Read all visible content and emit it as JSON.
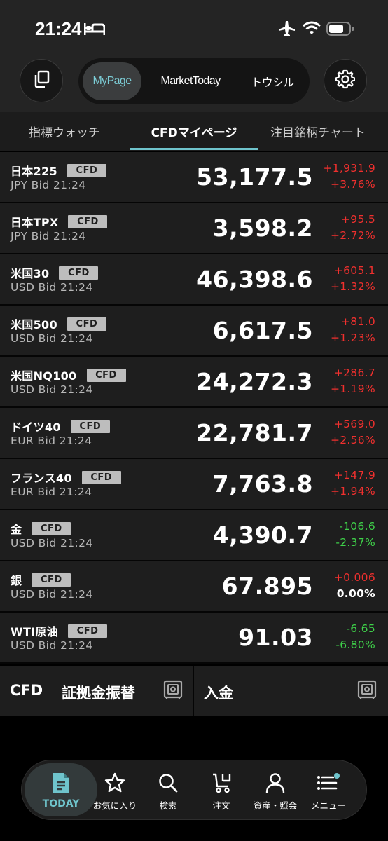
{
  "status": {
    "time": "21:24"
  },
  "header": {
    "segments": [
      {
        "label": "MyPage",
        "active": true
      },
      {
        "label": "MarketToday",
        "active": false
      },
      {
        "label": "トウシル",
        "active": false
      }
    ]
  },
  "tabs": [
    {
      "label": "指標ウォッチ",
      "active": false
    },
    {
      "label": "CFDマイページ",
      "active": true
    },
    {
      "label": "注目銘柄チャート",
      "active": false
    }
  ],
  "rows": [
    {
      "name": "日本225",
      "badge": "CFD",
      "sub": "JPY Bid 21:24",
      "price": "53,177.5",
      "change": "+1,931.9",
      "pct": "+3.76%",
      "dir": "up"
    },
    {
      "name": "日本TPX",
      "badge": "CFD",
      "sub": "JPY Bid 21:24",
      "price": "3,598.2",
      "change": "+95.5",
      "pct": "+2.72%",
      "dir": "up"
    },
    {
      "name": "米国30",
      "badge": "CFD",
      "sub": "USD Bid 21:24",
      "price": "46,398.6",
      "change": "+605.1",
      "pct": "+1.32%",
      "dir": "up"
    },
    {
      "name": "米国500",
      "badge": "CFD",
      "sub": "USD Bid 21:24",
      "price": "6,617.5",
      "change": "+81.0",
      "pct": "+1.23%",
      "dir": "up"
    },
    {
      "name": "米国NQ100",
      "badge": "CFD",
      "sub": "USD Bid 21:24",
      "price": "24,272.3",
      "change": "+286.7",
      "pct": "+1.19%",
      "dir": "up"
    },
    {
      "name": "ドイツ40",
      "badge": "CFD",
      "sub": "EUR Bid 21:24",
      "price": "22,781.7",
      "change": "+569.0",
      "pct": "+2.56%",
      "dir": "up"
    },
    {
      "name": "フランス40",
      "badge": "CFD",
      "sub": "EUR Bid 21:24",
      "price": "7,763.8",
      "change": "+147.9",
      "pct": "+1.94%",
      "dir": "up"
    },
    {
      "name": "金",
      "badge": "CFD",
      "sub": "USD Bid 21:24",
      "price": "4,390.7",
      "change": "-106.6",
      "pct": "-2.37%",
      "dir": "down"
    },
    {
      "name": "銀",
      "badge": "CFD",
      "sub": "USD Bid 21:24",
      "price": "67.895",
      "change": "+0.006",
      "pct": "0.00%",
      "dir": "up",
      "pct_dir": "flat"
    },
    {
      "name": "WTI原油",
      "badge": "CFD",
      "sub": "USD Bid 21:24",
      "price": "91.03",
      "change": "-6.65",
      "pct": "-6.80%",
      "dir": "down"
    }
  ],
  "actions": {
    "left_prefix": "CFD",
    "left_label": "証拠金振替",
    "right_label": "入金"
  },
  "nav": [
    {
      "label": "TODAY",
      "icon": "document-icon",
      "active": true
    },
    {
      "label": "お気に入り",
      "icon": "star-icon",
      "active": false
    },
    {
      "label": "検索",
      "icon": "search-icon",
      "active": false
    },
    {
      "label": "注文",
      "icon": "cart-icon",
      "active": false
    },
    {
      "label": "資産・照会",
      "icon": "person-icon",
      "active": false
    },
    {
      "label": "メニュー",
      "icon": "menu-icon",
      "active": false
    }
  ],
  "colors": {
    "accent": "#6fc4cc",
    "up": "#f0302e",
    "down": "#3fd34a"
  }
}
